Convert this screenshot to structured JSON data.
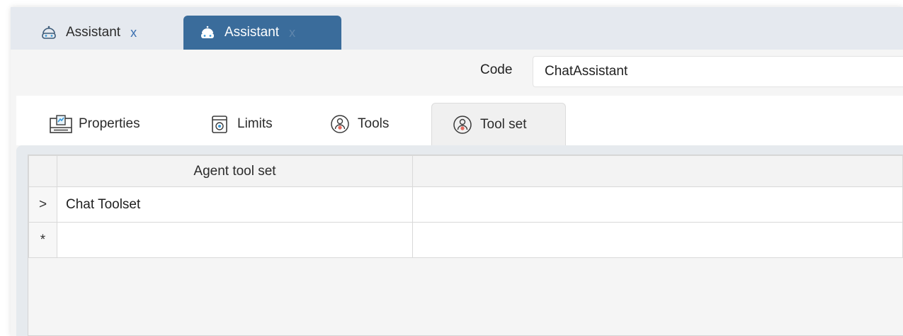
{
  "document_tabs": [
    {
      "label": "Assistant",
      "close": "x",
      "active": false,
      "icon": "assistant-outline-icon"
    },
    {
      "label": "Assistant",
      "close": "x",
      "active": true,
      "icon": "assistant-filled-icon"
    }
  ],
  "code_field": {
    "label": "Code",
    "value": "ChatAssistant"
  },
  "page_tabs": [
    {
      "label": "Properties",
      "icon": "properties-card-icon",
      "active": false
    },
    {
      "label": "Limits",
      "icon": "limits-icon",
      "active": false
    },
    {
      "label": "Tools",
      "icon": "tools-agent-icon",
      "active": false
    },
    {
      "label": "Tool set",
      "icon": "toolset-agent-icon",
      "active": true
    }
  ],
  "grid": {
    "columns": [
      "Agent tool set",
      ""
    ],
    "rows": [
      {
        "indicator": ">",
        "cells": [
          "Chat Toolset",
          ""
        ]
      },
      {
        "indicator": "*",
        "cells": [
          "",
          ""
        ]
      }
    ]
  },
  "colors": {
    "active_tab": "#3a6c9b",
    "tab_strip": "#e5e9ef",
    "accent_close": "#3a6fb0"
  }
}
